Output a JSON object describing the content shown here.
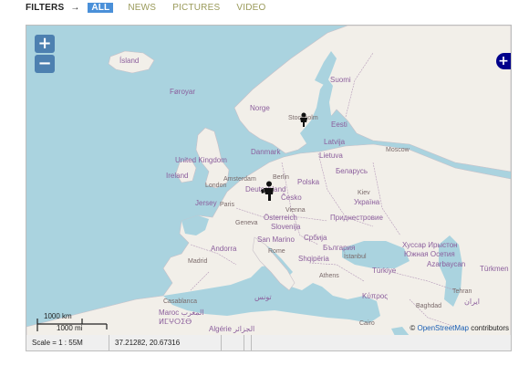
{
  "filters": {
    "label": "FILTERS",
    "arrow": "→",
    "tabs": [
      {
        "label": "ALL",
        "active": true
      },
      {
        "label": "NEWS",
        "active": false
      },
      {
        "label": "PICTURES",
        "active": false
      },
      {
        "label": "VIDEO",
        "active": false
      }
    ]
  },
  "map": {
    "zoom_in": "+",
    "zoom_out": "−",
    "layer_switcher": "+",
    "labels": {
      "island": "Ísland",
      "faroe": "Føroyar",
      "norge": "Norge",
      "suomi": "Suomi",
      "stockholm": "Stockholm",
      "eesti": "Eesti",
      "latvija": "Latvija",
      "lietuva": "Lietuva",
      "danmark": "Danmark",
      "moscow": "Moscow",
      "uk": "United Kingdom",
      "ireland": "Ireland",
      "amsterdam": "Amsterdam",
      "berlin": "Berlin",
      "polska": "Polska",
      "belarus": "Беларусь",
      "london": "London",
      "deutschland": "Deutschland",
      "kiev": "Kiev",
      "ukraina": "Україна",
      "jersey": "Jersey",
      "paris": "Paris",
      "cesko": "Česko",
      "vienna": "Vienna",
      "pridnestrovie": "Приднестровие",
      "geneva": "Geneva",
      "osterreich": "Österreich",
      "slovenija": "Slovenija",
      "sanmarino": "San Marino",
      "srbija": "Србија",
      "bulgaria": "България",
      "andorra": "Andorra",
      "rome": "Rome",
      "madrid": "Madrid",
      "shqiperia": "Shqipëria",
      "istanbul": "İstanbul",
      "hussar": "Хуссар Ирыстон",
      "south_ossetia": "Южная Осетия",
      "azarbaycan": "Azarbaycan",
      "turkmen": "Türkmen",
      "athens": "Athens",
      "turkiye": "Türkiye",
      "casablanca": "Casablanca",
      "maroc": "Maroc المغرب",
      "tamazight": "ⵍⵎⵖⵔⵉⴱ",
      "tunis": "تونس",
      "kypros": "Κύπρος",
      "tehran": "Tehran",
      "baghdad": "Baghdad",
      "iran": "ایران",
      "algerie": "Algérie الجزائر",
      "cairo": "Cairo"
    },
    "scale_km": "1000 km",
    "scale_mi": "1000 mi",
    "attribution_prefix": "©",
    "attribution_link": "OpenStreetMap",
    "attribution_suffix": " contributors"
  },
  "status": {
    "scale": "Scale = 1 : 55M",
    "coords": "37.21282, 20.67316"
  },
  "colors": {
    "sea": "#aad3df",
    "land": "#f2efe9",
    "border": "#b59ab9",
    "tab_active": "#4a90d9",
    "tab_inactive": "#9a9a5a",
    "control": "#00008b"
  }
}
